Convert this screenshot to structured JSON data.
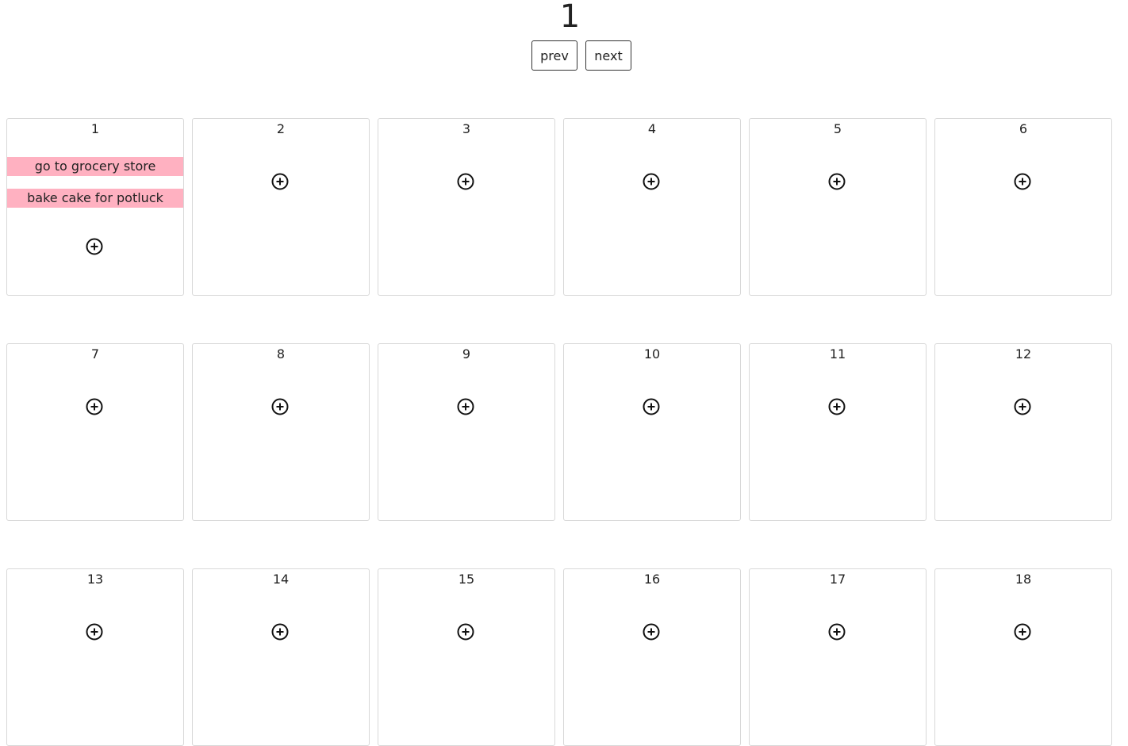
{
  "header": {
    "page_number": "1",
    "prev_label": "prev",
    "next_label": "next"
  },
  "task_color": "#ffb1c1",
  "add_icon": "plus-circle-icon",
  "days": [
    {
      "label": "1",
      "tasks": [
        "go to grocery store",
        "bake cake for potluck"
      ]
    },
    {
      "label": "2",
      "tasks": []
    },
    {
      "label": "3",
      "tasks": []
    },
    {
      "label": "4",
      "tasks": []
    },
    {
      "label": "5",
      "tasks": []
    },
    {
      "label": "6",
      "tasks": []
    },
    {
      "label": "7",
      "tasks": []
    },
    {
      "label": "8",
      "tasks": []
    },
    {
      "label": "9",
      "tasks": []
    },
    {
      "label": "10",
      "tasks": []
    },
    {
      "label": "11",
      "tasks": []
    },
    {
      "label": "12",
      "tasks": []
    },
    {
      "label": "13",
      "tasks": []
    },
    {
      "label": "14",
      "tasks": []
    },
    {
      "label": "15",
      "tasks": []
    },
    {
      "label": "16",
      "tasks": []
    },
    {
      "label": "17",
      "tasks": []
    },
    {
      "label": "18",
      "tasks": []
    }
  ]
}
